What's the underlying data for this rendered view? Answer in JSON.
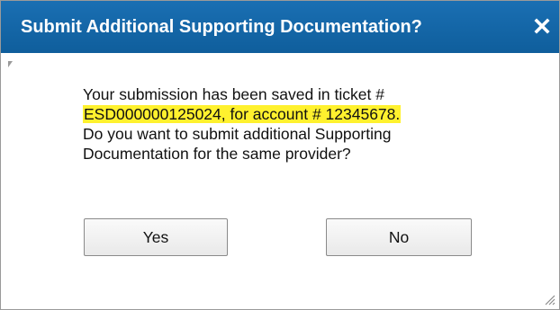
{
  "dialog": {
    "title": "Submit Additional Supporting Documentation?",
    "close_icon": "close-icon",
    "message": {
      "line1": "Your submission has been saved in ticket #",
      "line2_highlighted": "ESD000000125024, for account # 12345678.",
      "line3": "Do you want to submit additional Supporting",
      "line4": "Documentation for the same provider?"
    },
    "buttons": {
      "yes_label": "Yes",
      "no_label": "No"
    }
  },
  "colors": {
    "title_bar": "#1a6fb3",
    "highlight": "#fff12e"
  }
}
